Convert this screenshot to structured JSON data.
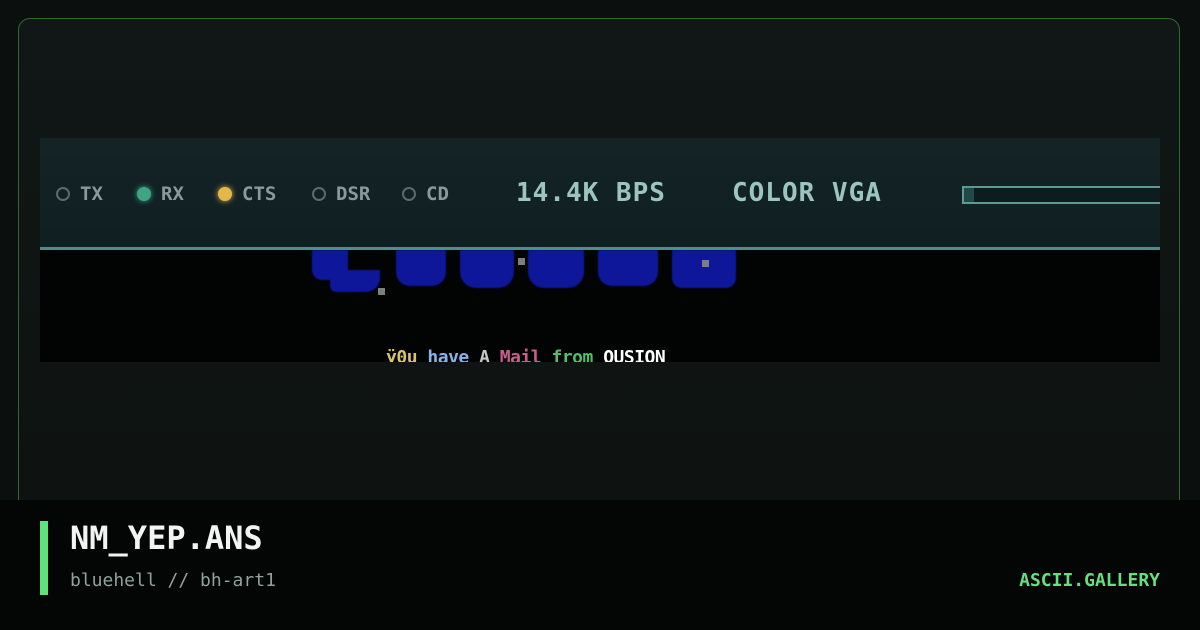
{
  "status_bar": {
    "indicators": [
      {
        "label": "TX",
        "state": "off",
        "color": "#5c6a69"
      },
      {
        "label": "RX",
        "state": "on",
        "color": "#3da583"
      },
      {
        "label": "CTS",
        "state": "on",
        "color": "#e5b64a"
      },
      {
        "label": "DSR",
        "state": "off",
        "color": "#5c6a69"
      },
      {
        "label": "CD",
        "state": "off",
        "color": "#5c6a69"
      }
    ],
    "baud_rate": "14.4K BPS",
    "display_mode": "COLOR VGA",
    "progress_fraction": 0.05
  },
  "art": {
    "ansi_text_segments": [
      {
        "text": "ÿ0u",
        "color": "#d6c36a"
      },
      {
        "text": " ",
        "color": "#ffffff"
      },
      {
        "text": "have",
        "color": "#8ab4e8"
      },
      {
        "text": " ",
        "color": "#ffffff"
      },
      {
        "text": "A",
        "color": "#c9c9c9"
      },
      {
        "text": " ",
        "color": "#ffffff"
      },
      {
        "text": "Mail",
        "color": "#c85e8a"
      },
      {
        "text": " ",
        "color": "#ffffff"
      },
      {
        "text": "from",
        "color": "#4fbf6a"
      },
      {
        "text": " ",
        "color": "#ffffff"
      },
      {
        "text": "QUSION",
        "color": "#ffffff"
      }
    ],
    "art_color": "#0e169a"
  },
  "footer": {
    "title": "NM_YEP.ANS",
    "subtitle": "bluehell // bh-art1",
    "brand": "ASCII.GALLERY",
    "accent_color": "#5fe27a"
  }
}
